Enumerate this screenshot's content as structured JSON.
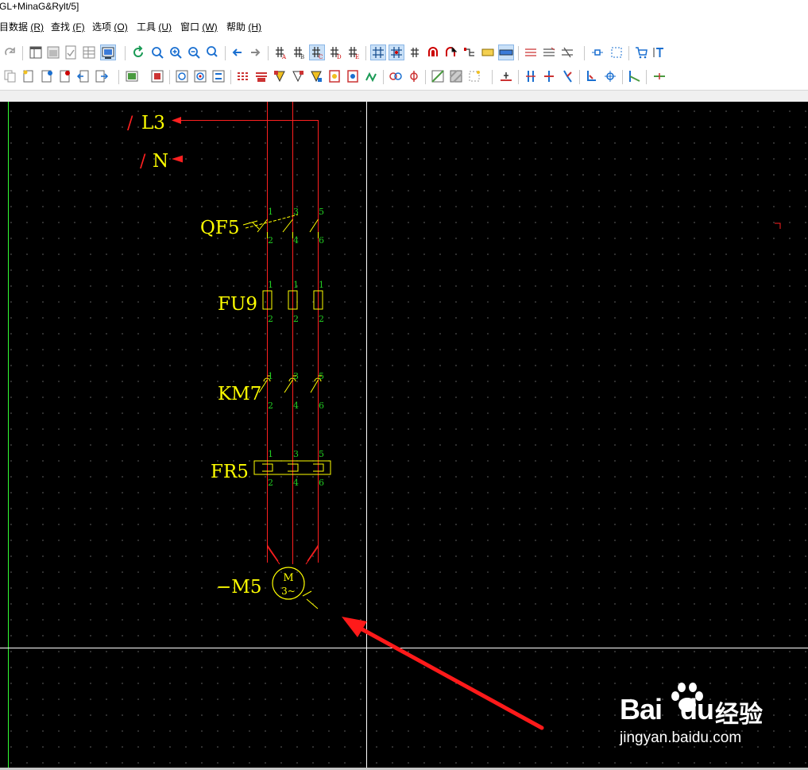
{
  "window": {
    "title": "GL+MinaG&Rylt/5]"
  },
  "menu": [
    {
      "label": "目数据",
      "key": "(R)"
    },
    {
      "label": "查找",
      "key": "(F)"
    },
    {
      "label": "选项",
      "key": "(O)"
    },
    {
      "label": "工具",
      "key": "(U)"
    },
    {
      "label": "窗口",
      "key": "(W)"
    },
    {
      "label": "帮助",
      "key": "(H)"
    }
  ],
  "diagram": {
    "refs": {
      "l3": "/L3",
      "n": "/N"
    },
    "labels": {
      "qf": "QF5",
      "fu": "FU9",
      "km": "KM7",
      "fr": "FR5",
      "motor": "−M5"
    },
    "motor_symbol": {
      "top": "M",
      "bottom": "3~"
    },
    "pins": {
      "qf": [
        "1",
        "3",
        "5",
        "2",
        "4",
        "6"
      ],
      "fu": [
        "1",
        "1",
        "1",
        "2",
        "2",
        "2"
      ],
      "km": [
        "1",
        "3",
        "5",
        "2",
        "4",
        "6"
      ],
      "fr": [
        "1",
        "3",
        "5",
        "2",
        "4",
        "6"
      ]
    },
    "colors": {
      "wire": "#ff2020",
      "symbol": "#ffff00",
      "pin": "#22cc22",
      "background": "#000000"
    }
  },
  "watermark": {
    "brand_left": "Bai",
    "brand_right": "du",
    "cn": "经验",
    "url": "jingyan.baidu.com"
  }
}
